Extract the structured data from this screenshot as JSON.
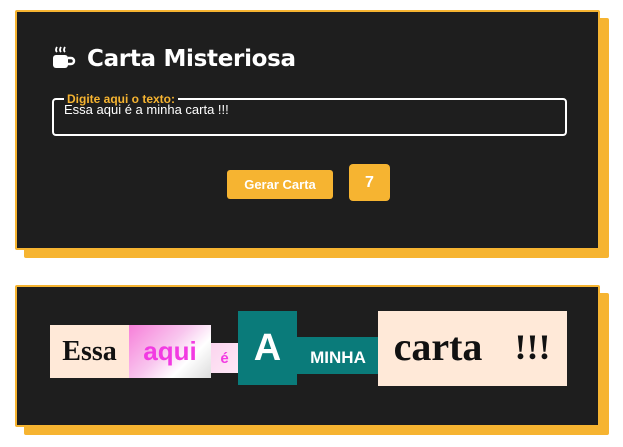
{
  "header": {
    "icon": "coffee-cup-icon",
    "title": "Carta Misteriosa"
  },
  "input": {
    "legend": "Digite aqui o texto:",
    "value": "Essa aqui é a minha carta !!!"
  },
  "actions": {
    "generate_label": "Gerar Carta",
    "word_count": "7"
  },
  "card": {
    "words": [
      "Essa",
      "aqui",
      "é",
      "A",
      "MINHA",
      "carta",
      "!!!"
    ]
  },
  "colors": {
    "accent": "#f6b431",
    "panel": "#1e1e1e",
    "pink": "#f23be2",
    "teal": "#0a7b7a",
    "peach": "#ffe9d8"
  }
}
